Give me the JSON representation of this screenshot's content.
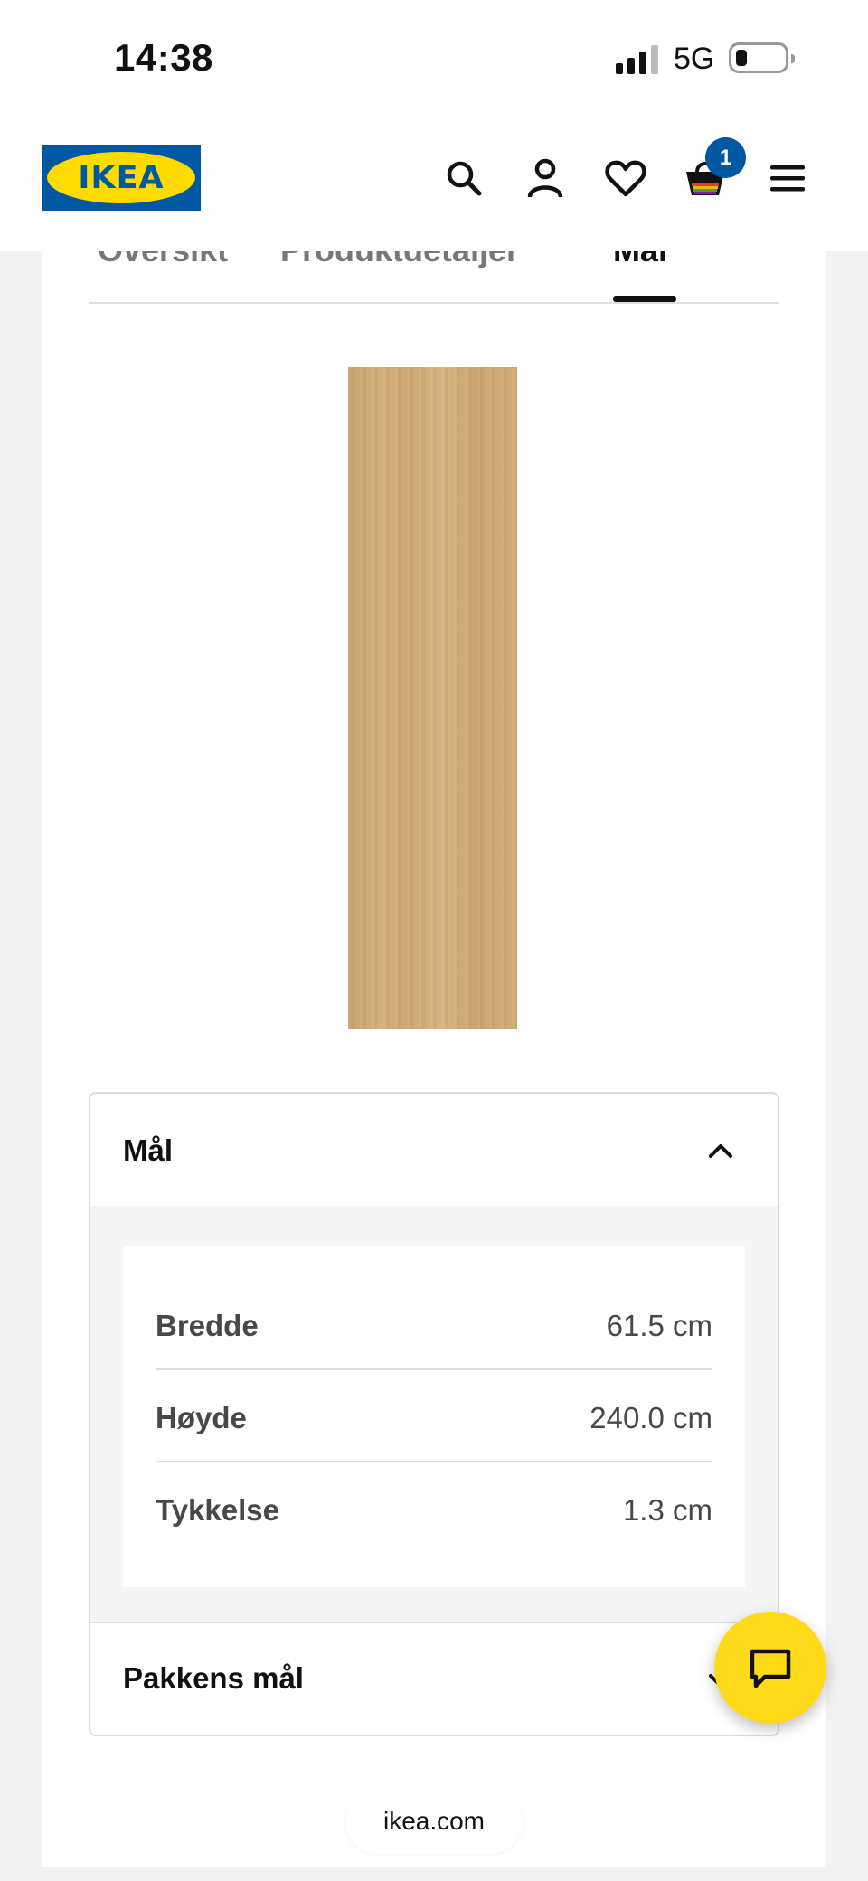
{
  "status_bar": {
    "time": "14:38",
    "network": "5G"
  },
  "header": {
    "logo_text": "IKEA",
    "cart_count": "1"
  },
  "tabs": [
    {
      "label": "Oversikt"
    },
    {
      "label": "Produktdetaljer"
    },
    {
      "label": "Mål",
      "active": true
    }
  ],
  "dimensions_section": {
    "title": "Mål",
    "rows": [
      {
        "label": "Bredde",
        "value": "61.5 cm"
      },
      {
        "label": "Høyde",
        "value": "240.0 cm"
      },
      {
        "label": "Tykkelse",
        "value": "1.3 cm"
      }
    ]
  },
  "package_section": {
    "title": "Pakkens mål"
  },
  "browser": {
    "url": "ikea.com"
  },
  "colors": {
    "ikea_blue": "#0058a3",
    "ikea_yellow": "#ffdb00",
    "chat_yellow": "#ffda1a"
  }
}
